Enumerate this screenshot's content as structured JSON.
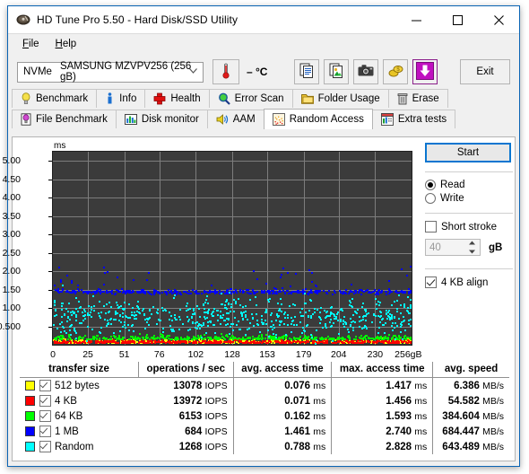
{
  "window": {
    "title": "HD Tune Pro 5.50 - Hard Disk/SSD Utility",
    "app_icon": "harddisk-icon",
    "minimize": "–",
    "maximize": "☐",
    "close": "✕",
    "accent_color": "#0a64b4"
  },
  "menubar": {
    "items": [
      {
        "label": "File",
        "accel": "F"
      },
      {
        "label": "Help",
        "accel": "H"
      }
    ]
  },
  "toolbar": {
    "drive": {
      "interface": "NVMe",
      "model": "SAMSUNG MZVPV256 (256 gB)",
      "chevron": "⌄"
    },
    "temperature": {
      "icon": "thermometer-icon",
      "value": "– °C"
    },
    "buttons": [
      {
        "name": "copy-text-button",
        "icon": "copy-text-icon"
      },
      {
        "name": "copy-image-button",
        "icon": "copy-image-icon"
      },
      {
        "name": "screenshot-button",
        "icon": "camera-icon"
      },
      {
        "name": "donate-button",
        "icon": "coins-icon"
      },
      {
        "name": "download-button",
        "icon": "download-arrow-icon"
      }
    ],
    "exit_label": "Exit"
  },
  "tabs": {
    "row1": [
      {
        "label": "Benchmark",
        "icon": "lightbulb-icon",
        "active": false
      },
      {
        "label": "Info",
        "icon": "info-icon",
        "active": false
      },
      {
        "label": "Health",
        "icon": "red-cross-icon",
        "active": false
      },
      {
        "label": "Error Scan",
        "icon": "magnifier-icon",
        "active": false
      },
      {
        "label": "Folder Usage",
        "icon": "folder-icon",
        "active": false
      },
      {
        "label": "Erase",
        "icon": "trash-icon",
        "active": false
      }
    ],
    "row2": [
      {
        "label": "File Benchmark",
        "icon": "file-benchmark-icon",
        "active": false
      },
      {
        "label": "Disk monitor",
        "icon": "bar-chart-icon",
        "active": false
      },
      {
        "label": "AAM",
        "icon": "speaker-icon",
        "active": false
      },
      {
        "label": "Random Access",
        "icon": "scatter-icon",
        "active": true
      },
      {
        "label": "Extra tests",
        "icon": "extra-tests-icon",
        "active": false
      }
    ]
  },
  "controls": {
    "start_label": "Start",
    "mode_read": {
      "label": "Read",
      "selected": true
    },
    "mode_write": {
      "label": "Write",
      "selected": false
    },
    "short_stroke": {
      "label": "Short stroke",
      "checked": false
    },
    "short_stroke_value": "40",
    "short_stroke_unit": "gB",
    "align_4kb": {
      "label": "4 KB align",
      "checked": true
    }
  },
  "chart_data": {
    "type": "scatter",
    "title": "",
    "ylabel": "ms",
    "xlabel": "gB",
    "ylim": [
      0,
      5.25
    ],
    "xlim": [
      0,
      256
    ],
    "yticks": [
      "0.500",
      "1.00",
      "1.50",
      "2.00",
      "2.50",
      "3.00",
      "3.50",
      "4.00",
      "4.50",
      "5.00"
    ],
    "ytick_values": [
      0.5,
      1.0,
      1.5,
      2.0,
      2.5,
      3.0,
      3.5,
      4.0,
      4.5,
      5.0
    ],
    "xticks": [
      "0",
      "25",
      "51",
      "76",
      "102",
      "128",
      "153",
      "179",
      "204",
      "230",
      "256gB"
    ],
    "xtick_values": [
      0,
      25,
      51,
      76,
      102,
      128,
      153,
      179,
      204,
      230,
      256
    ],
    "grid": true,
    "plot_bg": "#3b3b3b",
    "grid_color": "#7d7d7d",
    "legend_position": "table-below",
    "series": [
      {
        "name": "512 bytes",
        "color": "#ffff00",
        "center_ms": 0.076,
        "spread_ms": 0.09,
        "count": 520
      },
      {
        "name": "4 KB",
        "color": "#ff0000",
        "center_ms": 0.071,
        "spread_ms": 0.08,
        "count": 520
      },
      {
        "name": "64 KB",
        "color": "#00ff00",
        "center_ms": 0.162,
        "spread_ms": 0.13,
        "count": 430
      },
      {
        "name": "1 MB",
        "color": "#0000ff",
        "center_ms": 1.461,
        "spread_ms": 0.22,
        "count": 430
      },
      {
        "name": "Random",
        "color": "#00ffff",
        "center_ms": 0.788,
        "spread_ms": 0.45,
        "count": 640
      }
    ]
  },
  "results": {
    "columns": [
      "transfer size",
      "operations / sec",
      "avg. access time",
      "max. access time",
      "avg. speed"
    ],
    "rows": [
      {
        "color": "#ffff00",
        "checked": true,
        "size": "512 bytes",
        "iops": "13078 IOPS",
        "avg_access": "0.076 ms",
        "max_access": "1.417 ms",
        "avg_speed": "6.386 MB/s"
      },
      {
        "color": "#ff0000",
        "checked": true,
        "size": "4 KB",
        "iops": "13972 IOPS",
        "avg_access": "0.071 ms",
        "max_access": "1.456 ms",
        "avg_speed": "54.582 MB/s"
      },
      {
        "color": "#00ff00",
        "checked": true,
        "size": "64 KB",
        "iops": "6153 IOPS",
        "avg_access": "0.162 ms",
        "max_access": "1.593 ms",
        "avg_speed": "384.604 MB/s"
      },
      {
        "color": "#0000ff",
        "checked": true,
        "size": "1 MB",
        "iops": "684 IOPS",
        "avg_access": "1.461 ms",
        "max_access": "2.740 ms",
        "avg_speed": "684.447 MB/s"
      },
      {
        "color": "#00ffff",
        "checked": true,
        "size": "Random",
        "iops": "1268 IOPS",
        "avg_access": "0.788 ms",
        "max_access": "2.828 ms",
        "avg_speed": "643.489 MB/s"
      }
    ]
  }
}
